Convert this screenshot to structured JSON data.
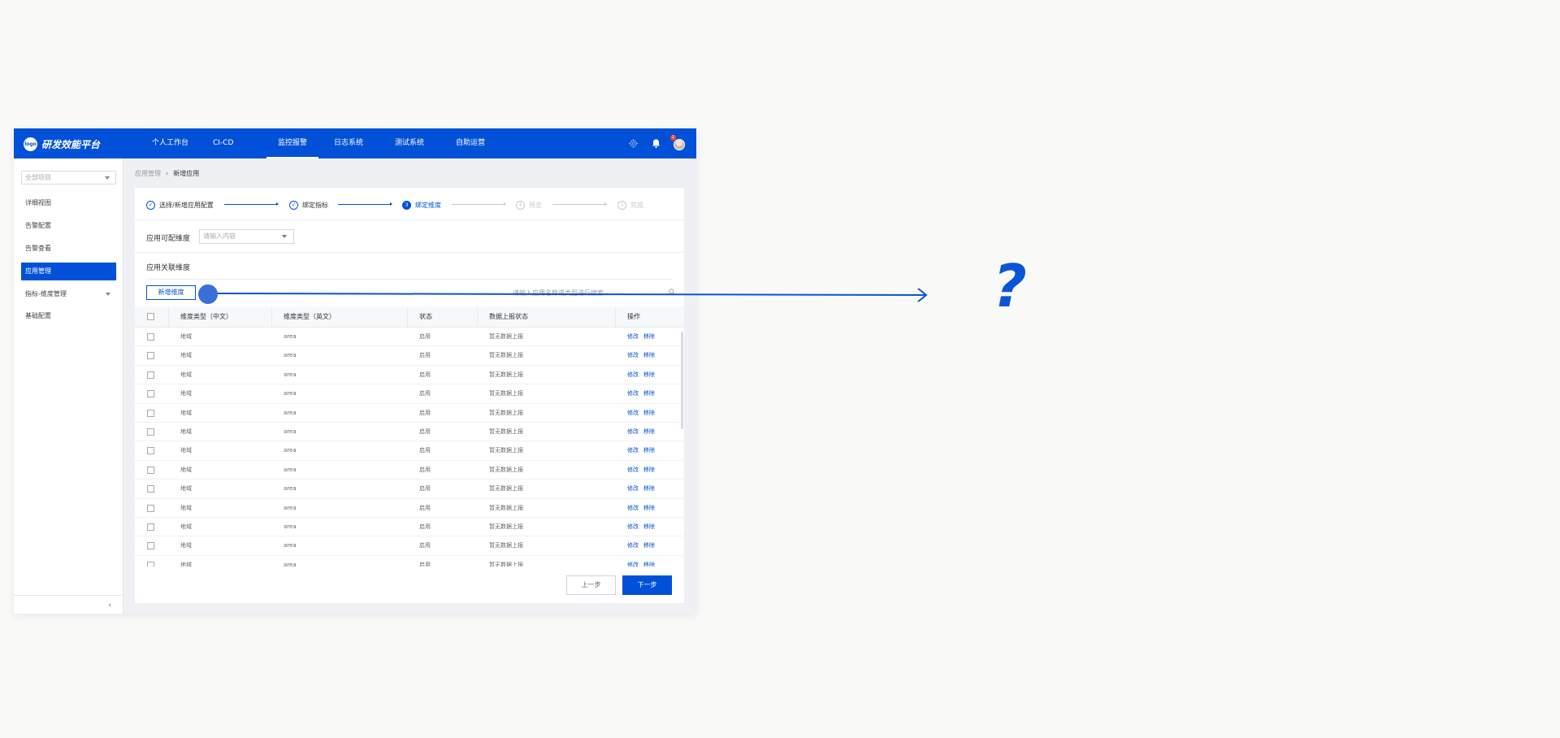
{
  "app": {
    "logo_badge": "logo",
    "title": "研发效能平台"
  },
  "nav": {
    "items": [
      "个人工作台",
      "CI-CD",
      "监控报警",
      "日志系统",
      "测试系统",
      "自助运营"
    ],
    "active": "监控报警"
  },
  "header": {
    "notification_count": "2",
    "icons": [
      "settings-icon",
      "bell-icon",
      "avatar"
    ]
  },
  "sidebar": {
    "project_select": "全部项目",
    "items": [
      "详细视图",
      "告警配置",
      "告警查看",
      "应用管理",
      "指标-维度管理",
      "基础配置"
    ],
    "active": "应用管理"
  },
  "breadcrumb": {
    "parent": "应用管理",
    "separator": "›",
    "current": "新增应用"
  },
  "steps": [
    {
      "label": "选择/新增应用配置",
      "state": "done",
      "marker": "✓"
    },
    {
      "label": "绑定指标",
      "state": "done",
      "marker": "✓"
    },
    {
      "label": "绑定维度",
      "state": "current",
      "marker": "3"
    },
    {
      "label": "预览",
      "state": "todo",
      "marker": "4"
    },
    {
      "label": "完成",
      "state": "todo",
      "marker": "5"
    }
  ],
  "form": {
    "dimension_label": "应用可配维度",
    "dimension_placeholder": "请输入内容",
    "section_title": "应用关联维度",
    "add_button": "新增维度",
    "search_placeholder": "请输入应用名称或类型进行搜索"
  },
  "table": {
    "columns": [
      "维度类型（中文）",
      "维度类型（英文）",
      "状态",
      "数据上报状态",
      "操作"
    ],
    "rows": [
      {
        "cn": "地域",
        "en": "area",
        "status": "启用",
        "report": "暂无数据上报"
      },
      {
        "cn": "地域",
        "en": "area",
        "status": "启用",
        "report": "暂无数据上报"
      },
      {
        "cn": "地域",
        "en": "area",
        "status": "启用",
        "report": "暂无数据上报"
      },
      {
        "cn": "地域",
        "en": "area",
        "status": "启用",
        "report": "暂无数据上报"
      },
      {
        "cn": "地域",
        "en": "area",
        "status": "启用",
        "report": "暂无数据上报"
      },
      {
        "cn": "地域",
        "en": "area",
        "status": "启用",
        "report": "暂无数据上报"
      },
      {
        "cn": "地域",
        "en": "area",
        "status": "启用",
        "report": "暂无数据上报"
      },
      {
        "cn": "地域",
        "en": "area",
        "status": "启用",
        "report": "暂无数据上报"
      },
      {
        "cn": "地域",
        "en": "area",
        "status": "启用",
        "report": "暂无数据上报"
      },
      {
        "cn": "地域",
        "en": "area",
        "status": "启用",
        "report": "暂无数据上报"
      },
      {
        "cn": "地域",
        "en": "area",
        "status": "启用",
        "report": "暂无数据上报"
      },
      {
        "cn": "地域",
        "en": "area",
        "status": "启用",
        "report": "暂无数据上报"
      },
      {
        "cn": "地域",
        "en": "area",
        "status": "启用",
        "report": "暂无数据上报"
      }
    ],
    "action_edit": "修改",
    "action_remove": "移除"
  },
  "footer": {
    "prev": "上一步",
    "next": "下一步"
  },
  "annotation": {
    "symbol": "?"
  },
  "colors": {
    "brand": "#0051d7",
    "annotation": "#0a54d6"
  }
}
